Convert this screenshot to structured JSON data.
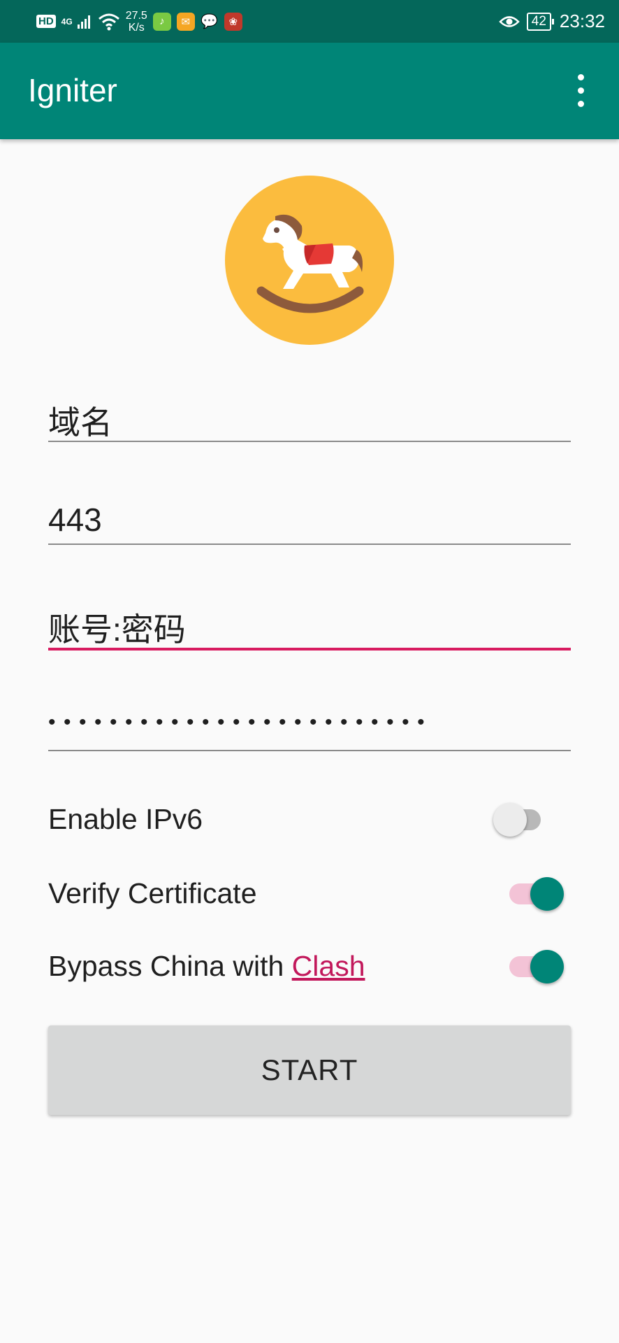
{
  "status_bar": {
    "hd_badge": "HD",
    "network": "4G",
    "speed_value": "27.5",
    "speed_unit": "K/s",
    "battery": "42",
    "time": "23:32",
    "notification_icons": [
      "qq-music-icon",
      "mail-icon",
      "wechat-icon",
      "app-icon"
    ]
  },
  "app_bar": {
    "title": "Igniter",
    "menu_icon": "more-vert-icon"
  },
  "logo": {
    "icon": "rocking-horse-icon",
    "background_color": "#fbbc3e"
  },
  "form": {
    "domain_field": {
      "value": "域名"
    },
    "port_field": {
      "value": "443"
    },
    "account_field": {
      "value": "账号:密码",
      "focused": true
    },
    "password_field": {
      "masked_value": "•••••••••••••••••••••••••"
    }
  },
  "switches": [
    {
      "label": "Enable IPv6",
      "checked": false
    },
    {
      "label": "Verify Certificate",
      "checked": true
    },
    {
      "label_prefix": "Bypass China with ",
      "label_link": "Clash",
      "checked": true
    }
  ],
  "start_button": {
    "label": "START"
  },
  "colors": {
    "status_bar": "#04675a",
    "app_bar": "#008577",
    "accent": "#d81b60",
    "switch_thumb_on": "#008577",
    "switch_track_on": "#f3c3d6",
    "switch_thumb_off": "#ececec",
    "switch_track_off": "#b8b8b8",
    "button_bg": "#d6d7d7"
  }
}
